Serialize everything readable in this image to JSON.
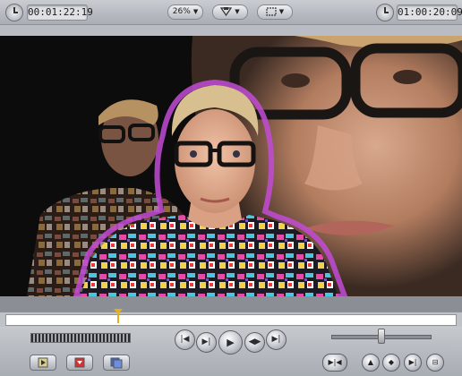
{
  "toolbar": {
    "current_timecode": "00:01:22:19",
    "zoom_label": "26%",
    "view_label": "",
    "overlay_label": "",
    "duration_timecode": "01:00:20:09"
  },
  "canvas": {
    "image": "video-frame-composite-man-with-glasses"
  },
  "timeline": {
    "playhead_position": 0.24
  },
  "transport": {
    "buttons": [
      "go-to-previous-edit",
      "play-in-to-out",
      "play",
      "play-around-current",
      "go-to-next-edit"
    ],
    "bottom_left": [
      "insert-edit",
      "mark-in-out",
      "overlay-edit"
    ],
    "bottom_right": [
      "mark-in",
      "mark-clip",
      "mark-out",
      "add-marker",
      "match-frame"
    ]
  },
  "colors": {
    "chrome": "#b9bcc2",
    "playhead": "#e3b116",
    "edit_yellow": "#d8cf8a",
    "edit_red": "#d23232",
    "edit_blue": "#3f66c9"
  }
}
